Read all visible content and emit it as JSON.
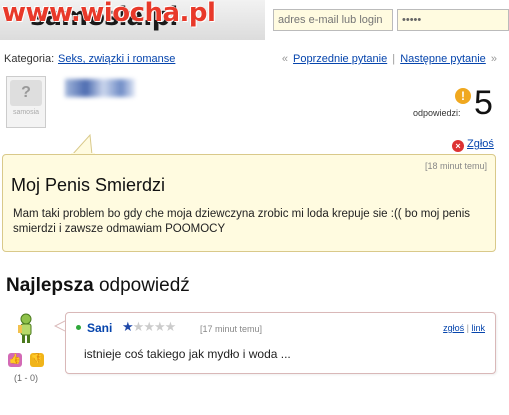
{
  "header": {
    "logo_partial": "samosia.pl",
    "watermark": "www.wiocha.pl",
    "email_placeholder": "adres e-mail lub login",
    "password_value": "•••••"
  },
  "category": {
    "label": "Kategoria:",
    "link": "Seks, związki i romanse"
  },
  "nav": {
    "prev": "Poprzednie pytanie",
    "separator": "|",
    "next": "Następne pytanie",
    "left_arrow": "«",
    "right_arrow": "»"
  },
  "avatar_logo": "samosia",
  "answers": {
    "label": "odpowiedzi:",
    "count": "5",
    "badge": "!"
  },
  "report": {
    "label": "Zgłoś"
  },
  "question": {
    "time": "[18 minut temu]",
    "title": "Moj Penis Smierdzi",
    "body": "Mam taki problem bo gdy che moja dziewczyna zrobic mi loda krepuje sie :(( bo moj penis smierdzi i zawsze odmawiam POOMOCY"
  },
  "best_answer": {
    "heading_bold": "Najlepsza",
    "heading_rest": "odpowiedź",
    "user": "Sani",
    "rating": 1,
    "rating_max": 5,
    "time": "[17 minut temu]",
    "report": "zgłoś",
    "separator": "|",
    "link": "link",
    "text": "istnieje coś takiego jak mydło i woda ...",
    "votes": "(1 - 0)",
    "colors": {
      "star_on": "#1f48a8",
      "star_off": "#cccccc"
    }
  }
}
